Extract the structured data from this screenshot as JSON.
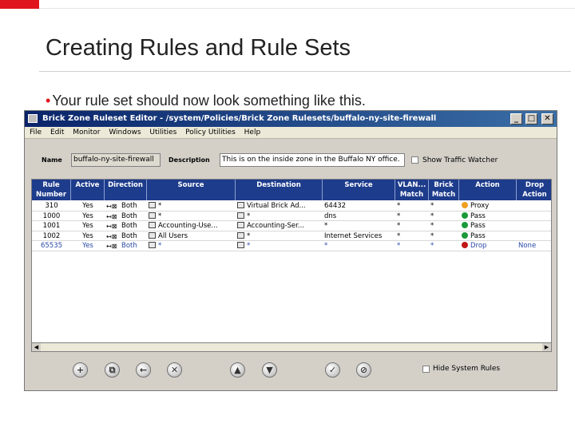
{
  "slide": {
    "title": "Creating Rules and Rule Sets",
    "bullet": "Your rule set should now look something like this."
  },
  "window": {
    "title": "Brick Zone Ruleset Editor - /system/Policies/Brick Zone Rulesets/buffalo-ny-site-firewall",
    "menu": [
      "File",
      "Edit",
      "Monitor",
      "Windows",
      "Utilities",
      "Policy Utilities",
      "Help"
    ],
    "name_label": "Name",
    "name_value": "buffalo-ny-site-firewall",
    "description_label": "Description",
    "description_value": "This is on the inside zone in the Buffalo NY office.",
    "show_traffic_label": "Show Traffic Watcher",
    "hide_system_rules_label": "Hide System Rules"
  },
  "table": {
    "headers": [
      "Rule\nNumber",
      "Active",
      "Direction",
      "Source",
      "Destination",
      "Service",
      "VLAN...\nMatch",
      "Brick\nMatch",
      "Action",
      "Drop\nAction"
    ],
    "rows": [
      {
        "rule": "310",
        "active": "Yes",
        "direction": "Both",
        "source": "*",
        "destination": "Virtual Brick Ad...",
        "service": "64432",
        "vlan": "*",
        "brick": "*",
        "action": "Proxy",
        "action_color": "#f0a020",
        "drop": ""
      },
      {
        "rule": "1000",
        "active": "Yes",
        "direction": "Both",
        "source": "*",
        "destination": "*",
        "service": "dns",
        "vlan": "*",
        "brick": "*",
        "action": "Pass",
        "action_color": "#1a9a3a",
        "drop": ""
      },
      {
        "rule": "1001",
        "active": "Yes",
        "direction": "Both",
        "source": "Accounting-Use...",
        "destination": "Accounting-Ser...",
        "service": "*",
        "vlan": "*",
        "brick": "*",
        "action": "Pass",
        "action_color": "#1a9a3a",
        "drop": ""
      },
      {
        "rule": "1002",
        "active": "Yes",
        "direction": "Both",
        "source": "All Users",
        "destination": "*",
        "service": "Internet Services",
        "vlan": "*",
        "brick": "*",
        "action": "Pass",
        "action_color": "#1a9a3a",
        "drop": ""
      },
      {
        "rule": "65535",
        "active": "Yes",
        "direction": "Both",
        "source": "*",
        "destination": "*",
        "service": "*",
        "vlan": "*",
        "brick": "*",
        "action": "Drop",
        "action_color": "#c01818",
        "drop": "None"
      }
    ]
  },
  "toolbar": {
    "buttons": [
      "add",
      "copy",
      "back",
      "delete",
      "move-up",
      "move-down",
      "apply",
      "cancel"
    ]
  },
  "colors": {
    "accent_red": "#e0141c",
    "header_blue": "#1e3c8c"
  }
}
